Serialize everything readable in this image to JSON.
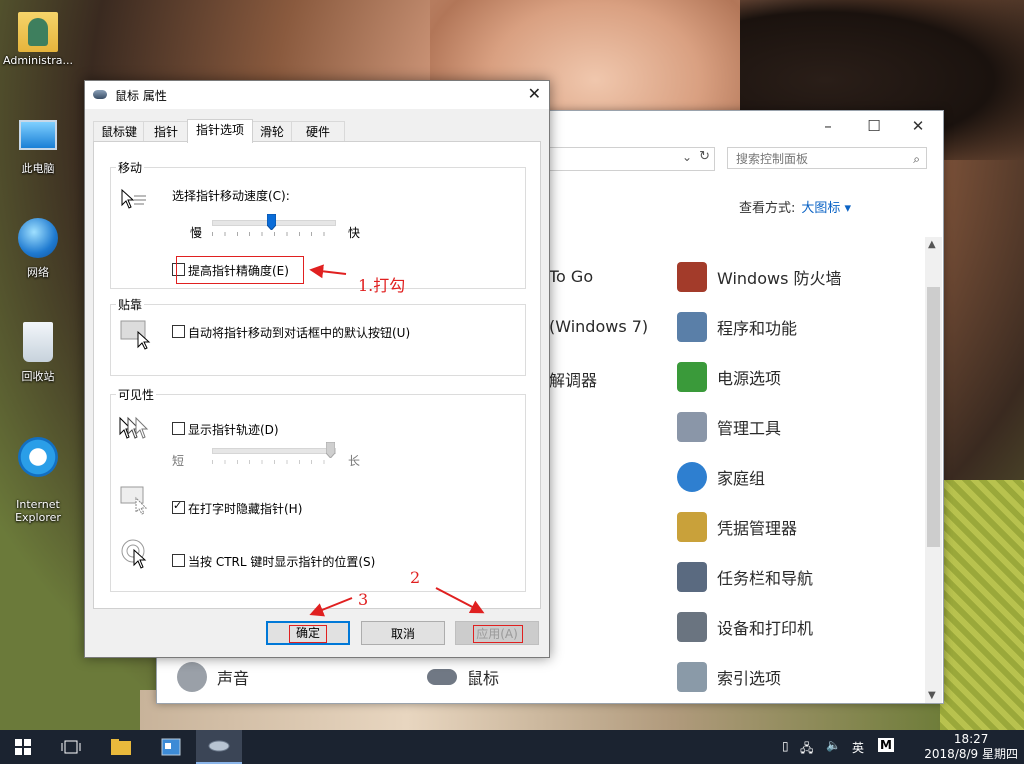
{
  "desktop": {
    "icons": [
      {
        "label": "Administra..."
      },
      {
        "label": "此电脑"
      },
      {
        "label": "网络"
      },
      {
        "label": "回收站"
      },
      {
        "label": "Internet\nExplorer"
      }
    ]
  },
  "control_panel": {
    "search_placeholder": "搜索控制面板",
    "view_by_label": "查看方式:",
    "view_by_value": "大图标 ▾",
    "partial_items": [
      "To Go",
      "(Windows 7)",
      "解调器"
    ],
    "items": [
      {
        "label": "Windows 防火墙",
        "color": "#a33b2a"
      },
      {
        "label": "程序和功能",
        "color": "#5a7fa8"
      },
      {
        "label": "电源选项",
        "color": "#3a9a3a"
      },
      {
        "label": "管理工具",
        "color": "#8a96a8"
      },
      {
        "label": "家庭组",
        "color": "#2e7fd0"
      },
      {
        "label": "凭据管理器",
        "color": "#c9a13a"
      },
      {
        "label": "任务栏和导航",
        "color": "#5a6a80"
      },
      {
        "label": "设备和打印机",
        "color": "#6a7480"
      },
      {
        "label": "索引选项",
        "color": "#8a9aa8"
      },
      {
        "label": "声音",
        "color": "#9aa0a8"
      },
      {
        "label": "鼠标",
        "color": "#707884"
      }
    ]
  },
  "dialog": {
    "title": "鼠标 属性",
    "tabs": [
      "鼠标键",
      "指针",
      "指针选项",
      "滑轮",
      "硬件"
    ],
    "active_tab": "指针选项",
    "motion": {
      "group_label": "移动",
      "speed_label": "选择指针移动速度(C):",
      "slow": "慢",
      "fast": "快",
      "speed_level": 0.5,
      "precision_label": "提高指针精确度(E)",
      "precision_checked": false
    },
    "snap": {
      "group_label": "贴靠",
      "snap_label": "自动将指针移动到对话框中的默认按钮(U)",
      "snap_checked": false
    },
    "visibility": {
      "group_label": "可见性",
      "trails_label": "显示指针轨迹(D)",
      "trails_checked": false,
      "short": "短",
      "long": "长",
      "trail_level": 1.0,
      "hide_label": "在打字时隐藏指针(H)",
      "hide_checked": true,
      "ctrl_label": "当按 CTRL 键时显示指针的位置(S)",
      "ctrl_checked": false
    },
    "buttons": {
      "ok": "确定",
      "cancel": "取消",
      "apply": "应用(A)"
    }
  },
  "annotations": {
    "step1": "1.打勾",
    "step2": "2",
    "step3": "3",
    "color": "#e02020"
  },
  "taskbar": {
    "lang": "英",
    "ime": "M",
    "time": "18:27",
    "date": "2018/8/9 星期四"
  }
}
